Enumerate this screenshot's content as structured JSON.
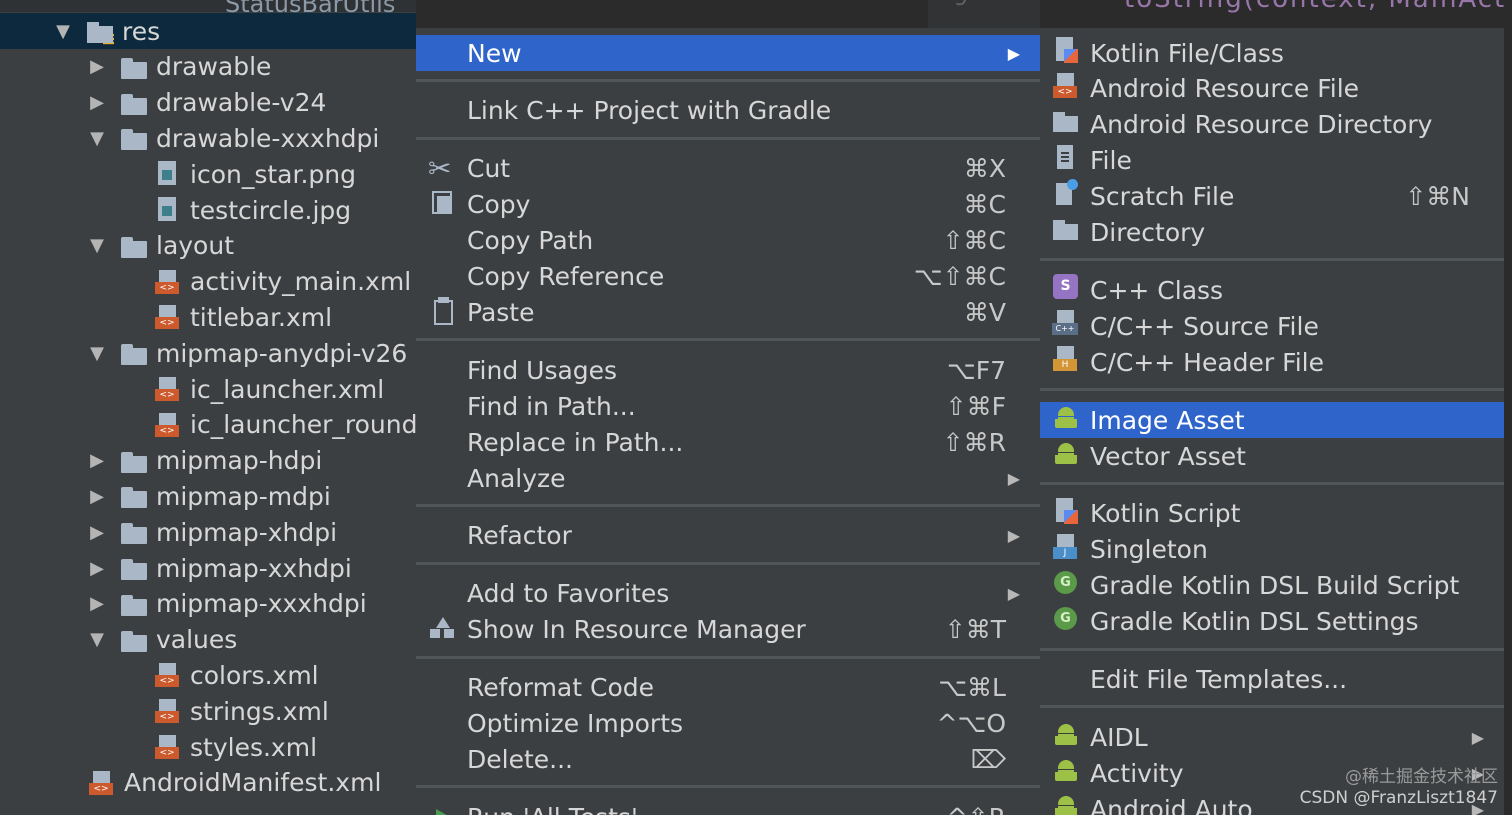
{
  "background_text": {
    "editor_fragment": "toString(context, MainAct",
    "gutter_fragment": "9",
    "tree_fragment": "StatusBarUtils"
  },
  "tree": {
    "items": [
      {
        "label": "res",
        "depth": 0,
        "arrow": "expanded",
        "icon": "res-folder-icon",
        "selected": true
      },
      {
        "label": "drawable",
        "depth": 1,
        "arrow": "collapsed",
        "icon": "folder-icon"
      },
      {
        "label": "drawable-v24",
        "depth": 1,
        "arrow": "collapsed",
        "icon": "folder-icon"
      },
      {
        "label": "drawable-xxxhdpi",
        "depth": 1,
        "arrow": "expanded",
        "icon": "folder-icon"
      },
      {
        "label": "icon_star.png",
        "depth": 2,
        "arrow": "none",
        "icon": "image-file-icon"
      },
      {
        "label": "testcircle.jpg",
        "depth": 2,
        "arrow": "none",
        "icon": "image-file-icon"
      },
      {
        "label": "layout",
        "depth": 1,
        "arrow": "expanded",
        "icon": "folder-icon"
      },
      {
        "label": "activity_main.xml",
        "depth": 2,
        "arrow": "none",
        "icon": "xml-file-icon"
      },
      {
        "label": "titlebar.xml",
        "depth": 2,
        "arrow": "none",
        "icon": "xml-file-icon"
      },
      {
        "label": "mipmap-anydpi-v26",
        "depth": 1,
        "arrow": "expanded",
        "icon": "folder-icon"
      },
      {
        "label": "ic_launcher.xml",
        "depth": 2,
        "arrow": "none",
        "icon": "xml-file-icon"
      },
      {
        "label": "ic_launcher_round.",
        "depth": 2,
        "arrow": "none",
        "icon": "xml-file-icon"
      },
      {
        "label": "mipmap-hdpi",
        "depth": 1,
        "arrow": "collapsed",
        "icon": "folder-icon"
      },
      {
        "label": "mipmap-mdpi",
        "depth": 1,
        "arrow": "collapsed",
        "icon": "folder-icon"
      },
      {
        "label": "mipmap-xhdpi",
        "depth": 1,
        "arrow": "collapsed",
        "icon": "folder-icon"
      },
      {
        "label": "mipmap-xxhdpi",
        "depth": 1,
        "arrow": "collapsed",
        "icon": "folder-icon"
      },
      {
        "label": "mipmap-xxxhdpi",
        "depth": 1,
        "arrow": "collapsed",
        "icon": "folder-icon"
      },
      {
        "label": "values",
        "depth": 1,
        "arrow": "expanded",
        "icon": "folder-icon"
      },
      {
        "label": "colors.xml",
        "depth": 2,
        "arrow": "none",
        "icon": "xml-file-icon"
      },
      {
        "label": "strings.xml",
        "depth": 2,
        "arrow": "none",
        "icon": "xml-file-icon"
      },
      {
        "label": "styles.xml",
        "depth": 2,
        "arrow": "none",
        "icon": "xml-file-icon"
      },
      {
        "label": "AndroidManifest.xml",
        "depth": 0,
        "arrow": "none",
        "icon": "xml-file-icon"
      }
    ]
  },
  "context_menu": {
    "groups": [
      [
        {
          "label": "New",
          "shortcut": "",
          "submenu": true,
          "selected": true
        }
      ],
      [
        {
          "label": "Link C++ Project with Gradle",
          "shortcut": ""
        }
      ],
      [
        {
          "label": "Cut",
          "shortcut": "⌘X",
          "icon": "scissors-icon"
        },
        {
          "label": "Copy",
          "shortcut": "⌘C",
          "icon": "copy-icon"
        },
        {
          "label": "Copy Path",
          "shortcut": "⇧⌘C"
        },
        {
          "label": "Copy Reference",
          "shortcut": "⌥⇧⌘C"
        },
        {
          "label": "Paste",
          "shortcut": "⌘V",
          "icon": "paste-icon"
        }
      ],
      [
        {
          "label": "Find Usages",
          "shortcut": "⌥F7"
        },
        {
          "label": "Find in Path...",
          "shortcut": "⇧⌘F"
        },
        {
          "label": "Replace in Path...",
          "shortcut": "⇧⌘R"
        },
        {
          "label": "Analyze",
          "shortcut": "",
          "submenu": true
        }
      ],
      [
        {
          "label": "Refactor",
          "shortcut": "",
          "submenu": true
        }
      ],
      [
        {
          "label": "Add to Favorites",
          "shortcut": "",
          "submenu": true
        },
        {
          "label": "Show In Resource Manager",
          "shortcut": "⇧⌘T",
          "icon": "resource-manager-icon"
        }
      ],
      [
        {
          "label": "Reformat Code",
          "shortcut": "⌥⌘L"
        },
        {
          "label": "Optimize Imports",
          "shortcut": "^⌥O"
        },
        {
          "label": "Delete...",
          "shortcut": "⌦"
        }
      ],
      [
        {
          "label": "Run 'All Tests'",
          "shortcut": "^⇧R",
          "icon": "run-icon"
        }
      ]
    ]
  },
  "new_submenu": {
    "groups": [
      [
        {
          "label": "Kotlin File/Class",
          "shortcut": "",
          "icon": "kotlin-file-icon"
        },
        {
          "label": "Android Resource File",
          "shortcut": "",
          "icon": "xml-file-icon"
        },
        {
          "label": "Android Resource Directory",
          "shortcut": "",
          "icon": "folder-icon"
        },
        {
          "label": "File",
          "shortcut": "",
          "icon": "file-icon"
        },
        {
          "label": "Scratch File",
          "shortcut": "⇧⌘N",
          "icon": "scratch-file-icon"
        },
        {
          "label": "Directory",
          "shortcut": "",
          "icon": "folder-icon"
        }
      ],
      [
        {
          "label": "C++ Class",
          "shortcut": "",
          "icon": "cpp-class-icon"
        },
        {
          "label": "C/C++ Source File",
          "shortcut": "",
          "icon": "cpp-source-icon"
        },
        {
          "label": "C/C++ Header File",
          "shortcut": "",
          "icon": "header-file-icon"
        }
      ],
      [
        {
          "label": "Image Asset",
          "shortcut": "",
          "icon": "android-icon",
          "selected": true
        },
        {
          "label": "Vector Asset",
          "shortcut": "",
          "icon": "android-icon"
        }
      ],
      [
        {
          "label": "Kotlin Script",
          "shortcut": "",
          "icon": "kotlin-file-icon"
        },
        {
          "label": "Singleton",
          "shortcut": "",
          "icon": "singleton-icon"
        },
        {
          "label": "Gradle Kotlin DSL Build Script",
          "shortcut": "",
          "icon": "gradle-icon"
        },
        {
          "label": "Gradle Kotlin DSL Settings",
          "shortcut": "",
          "icon": "gradle-icon"
        }
      ],
      [
        {
          "label": "Edit File Templates...",
          "shortcut": ""
        }
      ],
      [
        {
          "label": "AIDL",
          "shortcut": "",
          "icon": "android-icon",
          "submenu": true
        },
        {
          "label": "Activity",
          "shortcut": "",
          "icon": "android-icon",
          "submenu": true
        },
        {
          "label": "Android Auto",
          "shortcut": "",
          "icon": "android-icon",
          "submenu": true
        }
      ]
    ]
  },
  "watermark": {
    "line1": "@稀土掘金技术社区",
    "line2": "CSDN @FranzLiszt1847"
  },
  "colors": {
    "selection": "#2f65ca",
    "tree_selection": "#0d293e",
    "menu_bg": "#3c3f41",
    "separator": "#515658"
  }
}
